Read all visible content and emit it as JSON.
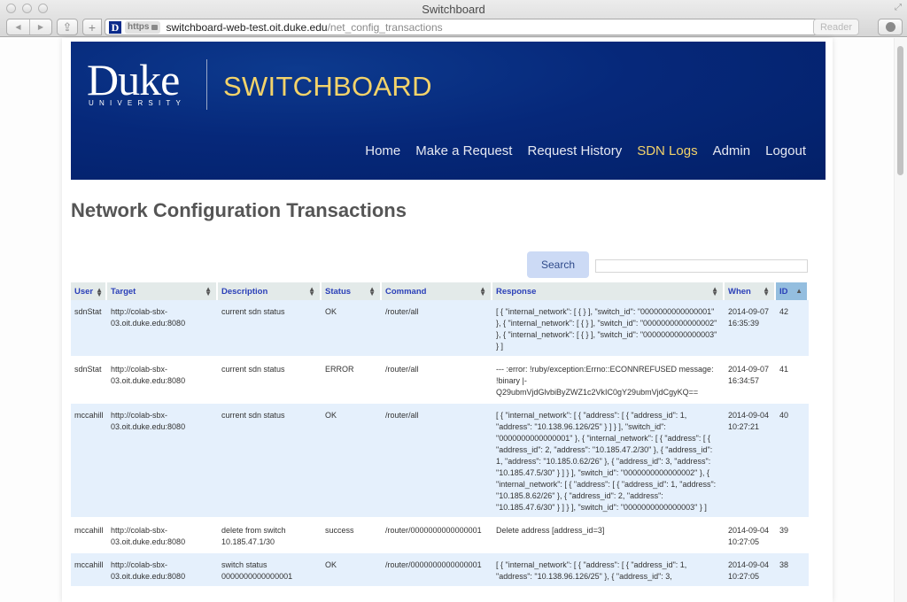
{
  "browser": {
    "window_title": "Switchboard",
    "url_scheme": "https",
    "url_host": "switchboard-web-test.oit.duke.edu",
    "url_path": "/net_config_transactions",
    "reader_label": "Reader",
    "favicon_letter": "D"
  },
  "header": {
    "logo_text": "Duke",
    "logo_subtext": "UNIVERSITY",
    "brand": "SWITCHBOARD",
    "nav": [
      {
        "label": "Home",
        "active": false
      },
      {
        "label": "Make a Request",
        "active": false
      },
      {
        "label": "Request History",
        "active": false
      },
      {
        "label": "SDN Logs",
        "active": true
      },
      {
        "label": "Admin",
        "active": false
      },
      {
        "label": "Logout",
        "active": false
      }
    ]
  },
  "page": {
    "title": "Network Configuration Transactions",
    "search_label": "Search",
    "search_value": ""
  },
  "table": {
    "columns": [
      {
        "label": "User",
        "sort": "both"
      },
      {
        "label": "Target",
        "sort": "both"
      },
      {
        "label": "Description",
        "sort": "both"
      },
      {
        "label": "Status",
        "sort": "both"
      },
      {
        "label": "Command",
        "sort": "both"
      },
      {
        "label": "Response",
        "sort": "both"
      },
      {
        "label": "When",
        "sort": "both"
      },
      {
        "label": "ID",
        "sort": "asc"
      }
    ],
    "rows": [
      {
        "user": "sdnStat",
        "target": "http://colab-sbx-03.oit.duke.edu:8080",
        "description": "current sdn status",
        "status": "OK",
        "command": "/router/all",
        "response": "[ { \"internal_network\": [ { } ], \"switch_id\": \"0000000000000001\" }, { \"internal_network\": [ { } ], \"switch_id\": \"0000000000000002\" }, { \"internal_network\": [ { } ], \"switch_id\": \"0000000000000003\" } ]",
        "when": "2014-09-07 16:35:39",
        "id": "42"
      },
      {
        "user": "sdnStat",
        "target": "http://colab-sbx-03.oit.duke.edu:8080",
        "description": "current sdn status",
        "status": "ERROR",
        "command": "/router/all",
        "response": "--- :error: !ruby/exception:Errno::ECONNREFUSED message: !binary |- Q29ubmVjdGlvbiByZWZ1c2VkIC0gY29ubmVjdCgyKQ==",
        "when": "2014-09-07 16:34:57",
        "id": "41"
      },
      {
        "user": "mccahill",
        "target": "http://colab-sbx-03.oit.duke.edu:8080",
        "description": "current sdn status",
        "status": "OK",
        "command": "/router/all",
        "response": "[ { \"internal_network\": [ { \"address\": [ { \"address_id\": 1, \"address\": \"10.138.96.126/25\" } ] } ], \"switch_id\": \"0000000000000001\" }, { \"internal_network\": [ { \"address\": [ { \"address_id\": 2, \"address\": \"10.185.47.2/30\" }, { \"address_id\": 1, \"address\": \"10.185.0.62/26\" }, { \"address_id\": 3, \"address\": \"10.185.47.5/30\" } ] } ], \"switch_id\": \"0000000000000002\" }, { \"internal_network\": [ { \"address\": [ { \"address_id\": 1, \"address\": \"10.185.8.62/26\" }, { \"address_id\": 2, \"address\": \"10.185.47.6/30\" } ] } ], \"switch_id\": \"0000000000000003\" } ]",
        "when": "2014-09-04 10:27:21",
        "id": "40"
      },
      {
        "user": "mccahill",
        "target": "http://colab-sbx-03.oit.duke.edu:8080",
        "description": "delete from switch 10.185.47.1/30",
        "status": "success",
        "command": "/router/0000000000000001",
        "response": "Delete address [address_id=3]",
        "when": "2014-09-04 10:27:05",
        "id": "39"
      },
      {
        "user": "mccahill",
        "target": "http://colab-sbx-03.oit.duke.edu:8080",
        "description": "switch status 0000000000000001",
        "status": "OK",
        "command": "/router/0000000000000001",
        "response": "[ { \"internal_network\": [ { \"address\": [ { \"address_id\": 1, \"address\": \"10.138.96.126/25\" }, { \"address_id\": 3,",
        "when": "2014-09-04 10:27:05",
        "id": "38"
      }
    ]
  }
}
